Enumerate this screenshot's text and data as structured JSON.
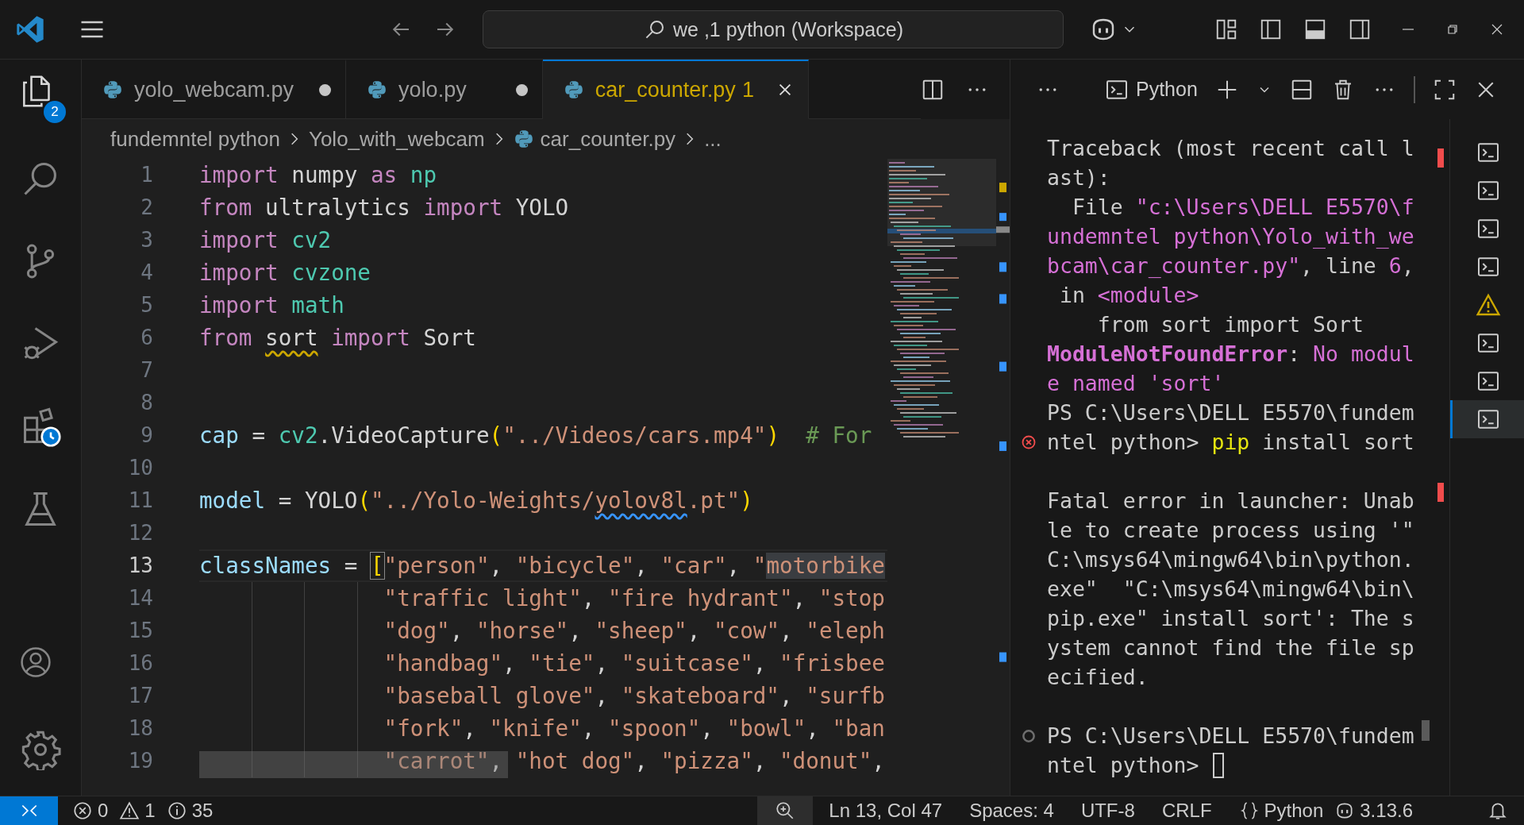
{
  "title_bar": {
    "search": "we ,1 python (Workspace)"
  },
  "activity_bar": {
    "items": [
      {
        "kind": "explorer",
        "selected": true,
        "badge": "2"
      },
      {
        "kind": "search",
        "selected": false
      },
      {
        "kind": "source-control",
        "selected": false
      },
      {
        "kind": "run-debug",
        "selected": false
      },
      {
        "kind": "extensions",
        "selected": false
      },
      {
        "kind": "testing",
        "selected": false
      }
    ],
    "bottom": [
      {
        "kind": "account"
      },
      {
        "kind": "settings"
      }
    ]
  },
  "tabs": [
    {
      "label": "yolo_webcam.py",
      "dirty": true,
      "selected": false,
      "warning": false
    },
    {
      "label": "yolo.py",
      "dirty": true,
      "selected": false,
      "warning": false
    },
    {
      "label": "car_counter.py",
      "problems": "1",
      "dirty": false,
      "selected": true,
      "warning": true
    }
  ],
  "breadcrumbs": [
    {
      "label": "fundemntel python",
      "kind": "folder"
    },
    {
      "label": "Yolo_with_webcam",
      "kind": "folder"
    },
    {
      "label": "car_counter.py",
      "kind": "python-file"
    },
    {
      "label": "...",
      "kind": "symbol"
    }
  ],
  "editor": {
    "lines": [
      {
        "number": "1",
        "current": false,
        "continuation": false,
        "tokens": [
          {
            "kind": "keyword",
            "text": "import "
          },
          {
            "kind": "plain",
            "text": "numpy "
          },
          {
            "kind": "keyword",
            "text": "as "
          },
          {
            "kind": "module",
            "text": "np"
          }
        ]
      },
      {
        "number": "2",
        "current": false,
        "continuation": false,
        "tokens": [
          {
            "kind": "keyword",
            "text": "from "
          },
          {
            "kind": "plain",
            "text": "ultralytics "
          },
          {
            "kind": "keyword",
            "text": "import "
          },
          {
            "kind": "plain",
            "text": "YOLO"
          }
        ]
      },
      {
        "number": "3",
        "current": false,
        "continuation": false,
        "tokens": [
          {
            "kind": "keyword",
            "text": "import "
          },
          {
            "kind": "module",
            "text": "cv2"
          }
        ]
      },
      {
        "number": "4",
        "current": false,
        "continuation": false,
        "tokens": [
          {
            "kind": "keyword",
            "text": "import "
          },
          {
            "kind": "module",
            "text": "cvzone"
          }
        ]
      },
      {
        "number": "5",
        "current": false,
        "continuation": false,
        "tokens": [
          {
            "kind": "keyword",
            "text": "import "
          },
          {
            "kind": "module",
            "text": "math"
          }
        ]
      },
      {
        "number": "6",
        "current": false,
        "continuation": false,
        "tokens": [
          {
            "kind": "keyword",
            "text": "from "
          },
          {
            "kind": "plain",
            "text": "sort",
            "warning": true
          },
          {
            "kind": "keyword",
            "text": " import "
          },
          {
            "kind": "plain",
            "text": "Sort"
          }
        ]
      },
      {
        "number": "7",
        "current": false,
        "continuation": false
      },
      {
        "number": "8",
        "current": false,
        "continuation": false
      },
      {
        "number": "9",
        "current": false,
        "continuation": false,
        "tokens": [
          {
            "kind": "variable",
            "text": "cap"
          },
          {
            "kind": "plain",
            "text": " = "
          },
          {
            "kind": "module",
            "text": "cv2"
          },
          {
            "kind": "plain",
            "text": ".VideoCapture"
          },
          {
            "kind": "bracket",
            "text": "("
          },
          {
            "kind": "string",
            "text": "\"../Videos/cars.mp4\""
          },
          {
            "kind": "bracket",
            "text": ")"
          },
          {
            "kind": "comment",
            "text": "  # For"
          }
        ]
      },
      {
        "number": "10",
        "current": false,
        "continuation": false
      },
      {
        "number": "11",
        "current": false,
        "continuation": false,
        "tokens": [
          {
            "kind": "variable",
            "text": "model"
          },
          {
            "kind": "plain",
            "text": " = YOLO"
          },
          {
            "kind": "bracket",
            "text": "("
          },
          {
            "kind": "string",
            "text": "\"../Yolo-Weights/"
          },
          {
            "kind": "string",
            "text": "yolov8l",
            "info": true
          },
          {
            "kind": "string",
            "text": ".pt\""
          },
          {
            "kind": "bracket",
            "text": ")"
          }
        ]
      },
      {
        "number": "12",
        "current": false,
        "continuation": false
      },
      {
        "number": "13",
        "current": true,
        "continuation": false,
        "tokens": [
          {
            "kind": "variable",
            "text": "classNames"
          },
          {
            "kind": "plain",
            "text": " = "
          },
          {
            "kind": "bracket",
            "text": "[",
            "matched": true
          },
          {
            "kind": "string",
            "text": "\"person\""
          },
          {
            "kind": "plain",
            "text": ", "
          },
          {
            "kind": "string",
            "text": "\"bicycle\""
          },
          {
            "kind": "plain",
            "text": ", "
          },
          {
            "kind": "string",
            "text": "\"car\""
          },
          {
            "kind": "plain",
            "text": ", "
          },
          {
            "kind": "string",
            "text": "\""
          },
          {
            "kind": "string",
            "text": "motorbike",
            "highlighted": true
          }
        ]
      },
      {
        "number": "14",
        "current": false,
        "continuation": true,
        "tokens": [
          {
            "kind": "string",
            "text": "\"traffic light\""
          },
          {
            "kind": "plain",
            "text": ", "
          },
          {
            "kind": "string",
            "text": "\"fire hydrant\""
          },
          {
            "kind": "plain",
            "text": ", "
          },
          {
            "kind": "string",
            "text": "\"stop"
          }
        ]
      },
      {
        "number": "15",
        "current": false,
        "continuation": true,
        "tokens": [
          {
            "kind": "string",
            "text": "\"dog\""
          },
          {
            "kind": "plain",
            "text": ", "
          },
          {
            "kind": "string",
            "text": "\"horse\""
          },
          {
            "kind": "plain",
            "text": ", "
          },
          {
            "kind": "string",
            "text": "\"sheep\""
          },
          {
            "kind": "plain",
            "text": ", "
          },
          {
            "kind": "string",
            "text": "\"cow\""
          },
          {
            "kind": "plain",
            "text": ", "
          },
          {
            "kind": "string",
            "text": "\"eleph"
          }
        ]
      },
      {
        "number": "16",
        "current": false,
        "continuation": true,
        "tokens": [
          {
            "kind": "string",
            "text": "\"handbag\""
          },
          {
            "kind": "plain",
            "text": ", "
          },
          {
            "kind": "string",
            "text": "\"tie\""
          },
          {
            "kind": "plain",
            "text": ", "
          },
          {
            "kind": "string",
            "text": "\"suitcase\""
          },
          {
            "kind": "plain",
            "text": ", "
          },
          {
            "kind": "string",
            "text": "\"frisbee"
          }
        ]
      },
      {
        "number": "17",
        "current": false,
        "continuation": true,
        "tokens": [
          {
            "kind": "string",
            "text": "\"baseball glove\""
          },
          {
            "kind": "plain",
            "text": ", "
          },
          {
            "kind": "string",
            "text": "\"skateboard\""
          },
          {
            "kind": "plain",
            "text": ", "
          },
          {
            "kind": "string",
            "text": "\"surfb"
          }
        ]
      },
      {
        "number": "18",
        "current": false,
        "continuation": true,
        "tokens": [
          {
            "kind": "string",
            "text": "\"fork\""
          },
          {
            "kind": "plain",
            "text": ", "
          },
          {
            "kind": "string",
            "text": "\"knife\""
          },
          {
            "kind": "plain",
            "text": ", "
          },
          {
            "kind": "string",
            "text": "\"spoon\""
          },
          {
            "kind": "plain",
            "text": ", "
          },
          {
            "kind": "string",
            "text": "\"bowl\""
          },
          {
            "kind": "plain",
            "text": ", "
          },
          {
            "kind": "string",
            "text": "\"ban"
          }
        ]
      },
      {
        "number": "19",
        "current": false,
        "continuation": true,
        "tokens": [
          {
            "kind": "string",
            "text": "\"carrot\""
          },
          {
            "kind": "plain",
            "text": ", "
          },
          {
            "kind": "string",
            "text": "\"hot dog\""
          },
          {
            "kind": "plain",
            "text": ", "
          },
          {
            "kind": "string",
            "text": "\"pizza\""
          },
          {
            "kind": "plain",
            "text": ", "
          },
          {
            "kind": "string",
            "text": "\"donut\""
          },
          {
            "kind": "plain",
            "text": ","
          }
        ]
      }
    ]
  },
  "terminal": {
    "title": "Python",
    "lines": [
      {
        "segs": [
          {
            "kind": "plain",
            "text": "Traceback (most recent call l"
          }
        ]
      },
      {
        "segs": [
          {
            "kind": "plain",
            "text": "ast):"
          }
        ]
      },
      {
        "segs": [
          {
            "kind": "plain",
            "text": "  File "
          },
          {
            "kind": "magenta",
            "text": "\"c:\\Users\\DELL E5570\\f"
          }
        ]
      },
      {
        "segs": [
          {
            "kind": "magenta",
            "text": "undemntel python\\Yolo_with_we"
          }
        ]
      },
      {
        "segs": [
          {
            "kind": "magenta",
            "text": "bcam\\car_counter.py\""
          },
          {
            "kind": "plain",
            "text": ", line "
          },
          {
            "kind": "magenta",
            "text": "6"
          },
          {
            "kind": "plain",
            "text": ","
          }
        ]
      },
      {
        "segs": [
          {
            "kind": "plain",
            "text": " in "
          },
          {
            "kind": "magenta",
            "text": "<module>"
          }
        ]
      },
      {
        "segs": [
          {
            "kind": "plain",
            "text": "    from sort import Sort"
          }
        ]
      },
      {
        "segs": [
          {
            "kind": "magenta-bold",
            "text": "ModuleNotFoundError"
          },
          {
            "kind": "plain",
            "text": ": "
          },
          {
            "kind": "magenta",
            "text": "No modul"
          }
        ]
      },
      {
        "segs": [
          {
            "kind": "magenta",
            "text": "e named 'sort'"
          }
        ]
      },
      {
        "segs": [
          {
            "kind": "plain",
            "text": "PS C:\\Users\\DELL E5570\\fundem"
          }
        ]
      },
      {
        "failed": true,
        "segs": [
          {
            "kind": "plain",
            "text": "ntel python> "
          },
          {
            "kind": "yellow",
            "text": "pip"
          },
          {
            "kind": "plain",
            "text": " install sort"
          }
        ]
      },
      {
        "space_before": true,
        "segs": [
          {
            "kind": "plain",
            "text": "Fatal error in launcher: Unab"
          }
        ]
      },
      {
        "segs": [
          {
            "kind": "plain",
            "text": "le to create process using '\""
          }
        ]
      },
      {
        "segs": [
          {
            "kind": "plain",
            "text": "C:\\msys64\\mingw64\\bin\\python."
          }
        ]
      },
      {
        "segs": [
          {
            "kind": "plain",
            "text": "exe\"  \"C:\\msys64\\mingw64\\bin\\"
          }
        ]
      },
      {
        "segs": [
          {
            "kind": "plain",
            "text": "pip.exe\" install sort': The s"
          }
        ]
      },
      {
        "segs": [
          {
            "kind": "plain",
            "text": "ystem cannot find the file sp"
          }
        ]
      },
      {
        "segs": [
          {
            "kind": "plain",
            "text": "ecified."
          }
        ]
      },
      {
        "space_before": true,
        "idle": true,
        "segs": [
          {
            "kind": "plain",
            "text": "PS C:\\Users\\DELL E5570\\fundem"
          }
        ]
      },
      {
        "cursor": true,
        "segs": [
          {
            "kind": "plain",
            "text": "ntel python> "
          }
        ]
      }
    ],
    "tabs": [
      {
        "kind": "terminal",
        "selected": false
      },
      {
        "kind": "terminal",
        "selected": false
      },
      {
        "kind": "terminal",
        "selected": false
      },
      {
        "kind": "terminal",
        "selected": false
      },
      {
        "kind": "warning",
        "selected": false
      },
      {
        "kind": "terminal",
        "selected": false
      },
      {
        "kind": "terminal",
        "selected": false
      },
      {
        "kind": "terminal",
        "selected": true
      }
    ]
  },
  "status_bar": {
    "errors": "0",
    "warnings": "1",
    "infos": "35",
    "position": "Ln 13, Col 47",
    "spaces": "Spaces: 4",
    "encoding": "UTF-8",
    "eol": "CRLF",
    "language": "Python",
    "version": "3.13.6"
  }
}
